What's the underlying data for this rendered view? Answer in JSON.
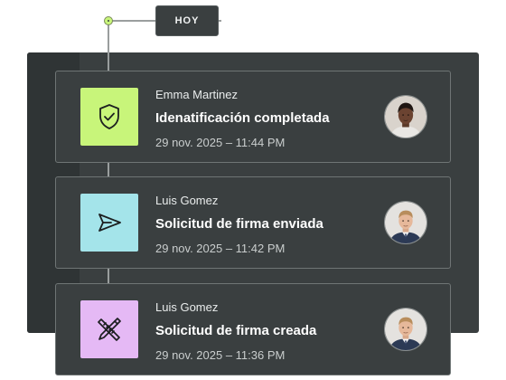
{
  "timeline": {
    "today_label": "HOY",
    "dot_color": "#c8f57a"
  },
  "cards": [
    {
      "user": "Emma Martinez",
      "title": "Idenatificación completada",
      "time": "29 nov. 2025 – 11:44 PM",
      "icon": "shield-check-icon",
      "icon_bg": "#c8f57a",
      "avatar": "woman-avatar"
    },
    {
      "user": "Luis Gomez",
      "title": "Solicitud de firma enviada",
      "time": "29 nov. 2025 – 11:42 PM",
      "icon": "send-icon",
      "icon_bg": "#a4e4ea",
      "avatar": "man-avatar"
    },
    {
      "user": "Luis Gomez",
      "title": "Solicitud de firma creada",
      "time": "29 nov. 2025 – 11:36 PM",
      "icon": "pencil-ruler-icon",
      "icon_bg": "#e5b9f5",
      "avatar": "man-avatar"
    }
  ]
}
